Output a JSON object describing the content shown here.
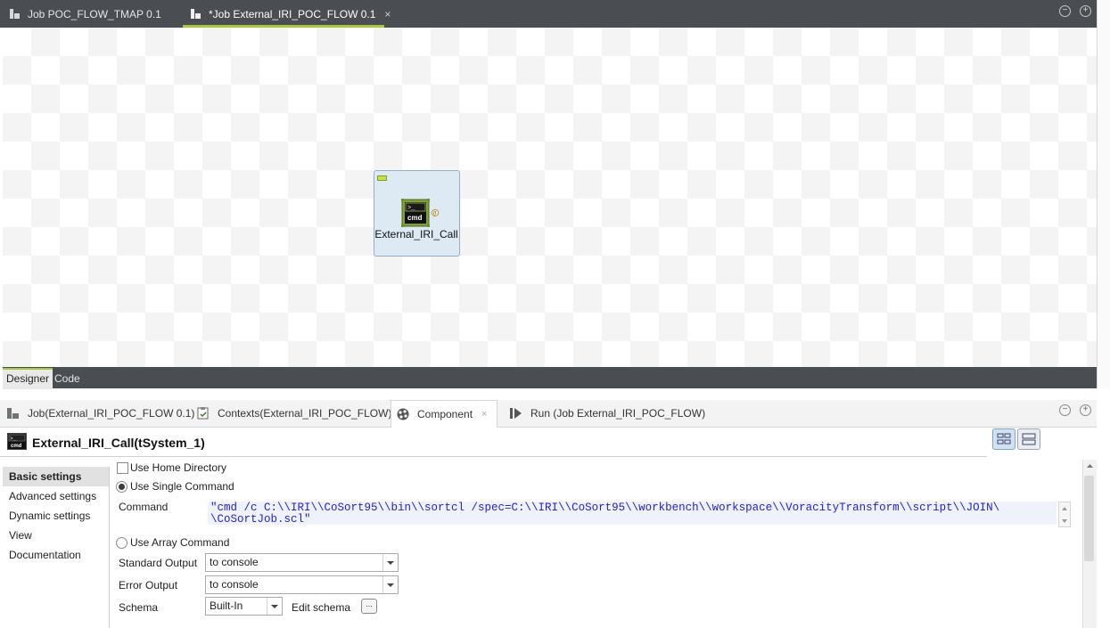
{
  "editor_tabs": [
    {
      "label": "Job POC_FLOW_TMAP 0.1",
      "active": false
    },
    {
      "label": "*Job External_IRI_POC_FLOW 0.1",
      "active": true
    }
  ],
  "editor_tab_close": "×",
  "window_controls": {
    "minimize": "−",
    "maximize": "+"
  },
  "canvas": {
    "component": {
      "icon_text": "cmd",
      "label": "External_IRI_Call",
      "connector": "0"
    }
  },
  "designer_tabs": [
    "Designer",
    "Code"
  ],
  "view_tabs": [
    {
      "label": "Job(External_IRI_POC_FLOW 0.1)",
      "icon": "job-icon"
    },
    {
      "label": "Contexts(External_IRI_POC_FLOW)",
      "icon": "contexts-icon"
    },
    {
      "label": "Component",
      "icon": "component-icon",
      "active": true
    },
    {
      "label": "Run (Job External_IRI_POC_FLOW)",
      "icon": "run-icon"
    }
  ],
  "view_tab_close": "×",
  "component": {
    "title": "External_IRI_Call(tSystem_1)",
    "icon_text": "cmd"
  },
  "settings_menu": [
    "Basic settings",
    "Advanced settings",
    "Dynamic settings",
    "View",
    "Documentation"
  ],
  "form": {
    "use_home_directory": {
      "label": "Use Home Directory",
      "checked": false
    },
    "use_single_command": {
      "label": "Use Single Command",
      "selected": true
    },
    "command": {
      "label": "Command",
      "line1": "\"cmd /c C:\\\\IRI\\\\CoSort95\\\\bin\\\\sortcl /spec=C:\\\\IRI\\\\CoSort95\\\\workbench\\\\workspace\\\\VoracityTransform\\\\script\\\\JOIN\\",
      "line2": "\\CoSortJob.scl\""
    },
    "use_array_command": {
      "label": "Use Array Command",
      "selected": false
    },
    "standard_output": {
      "label": "Standard Output",
      "value": "to console"
    },
    "error_output": {
      "label": "Error Output",
      "value": "to console"
    },
    "schema": {
      "label": "Schema",
      "value": "Built-In",
      "edit_label": "Edit schema",
      "button": "..."
    }
  },
  "colors": {
    "accent": "#a6c83a",
    "dark_bar": "#4a4d52",
    "command_text": "#2a20c8"
  }
}
